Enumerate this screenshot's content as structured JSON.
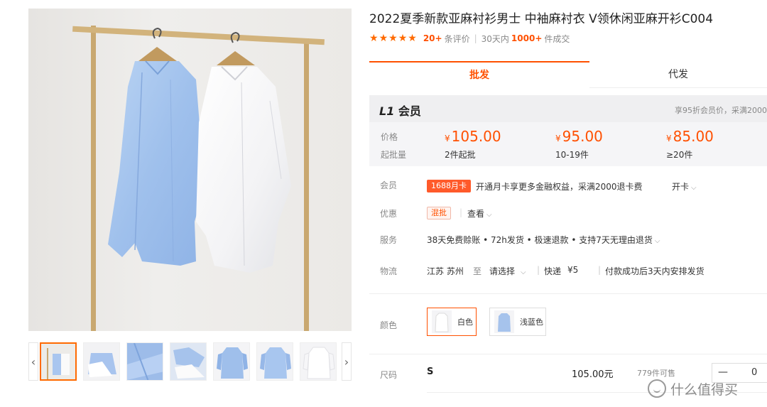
{
  "product": {
    "title": "2022夏季新款亚麻衬衫男士 中袖麻衬衣 V领休闲亚麻开衫C004",
    "review_count": "20+",
    "review_suffix": "条评价",
    "sales_period": "30天内",
    "sales_count": "1000+",
    "sales_suffix": "件成交",
    "stars": 5
  },
  "gallery": {
    "thumbnails": [
      "thumb-1",
      "thumb-2",
      "thumb-3",
      "thumb-4",
      "thumb-5",
      "thumb-6",
      "thumb-7"
    ],
    "selected_index": 0,
    "prev_icon": "‹",
    "next_icon": "›"
  },
  "tabs": [
    {
      "label": "批发",
      "active": true
    },
    {
      "label": "代发",
      "active": false
    }
  ],
  "pricing": {
    "member_level": "L1",
    "member_label": "会员",
    "member_note": "享95折会员价，采满2000",
    "price_label": "价格",
    "qty_label": "起批量",
    "currency": "¥",
    "tiers": [
      {
        "price": "105.00",
        "qty": "2件起批"
      },
      {
        "price": "95.00",
        "qty": "10-19件"
      },
      {
        "price": "85.00",
        "qty": "≥20件"
      }
    ]
  },
  "info": {
    "member": {
      "label": "会员",
      "badge": "1688月卡",
      "text": "开通月卡享更多金融权益，采满2000退卡费",
      "action": "开卡"
    },
    "discount": {
      "label": "优惠",
      "badge": "混批",
      "action": "查看"
    },
    "service": {
      "label": "服务",
      "text": "38天免费赊账 • 72h发货 • 极速退款 • 支持7天无理由退货"
    },
    "logistics": {
      "label": "物流",
      "origin": "江苏 苏州",
      "to": "至",
      "destination": "请选择",
      "express": "快递",
      "fee": "¥5",
      "ship_note": "付款成功后3天内安排发货"
    }
  },
  "color": {
    "label": "颜色",
    "options": [
      {
        "name": "白色",
        "selected": true
      },
      {
        "name": "浅蓝色",
        "selected": false
      }
    ]
  },
  "size": {
    "label": "尺码",
    "rows": [
      {
        "size": "S",
        "price": "105.00元",
        "stock": "779件可售",
        "qty": "0"
      }
    ]
  },
  "watermark": {
    "text": "什么值得买"
  },
  "colors": {
    "accent": "#ff5000",
    "badge": "#ff5a2a"
  }
}
